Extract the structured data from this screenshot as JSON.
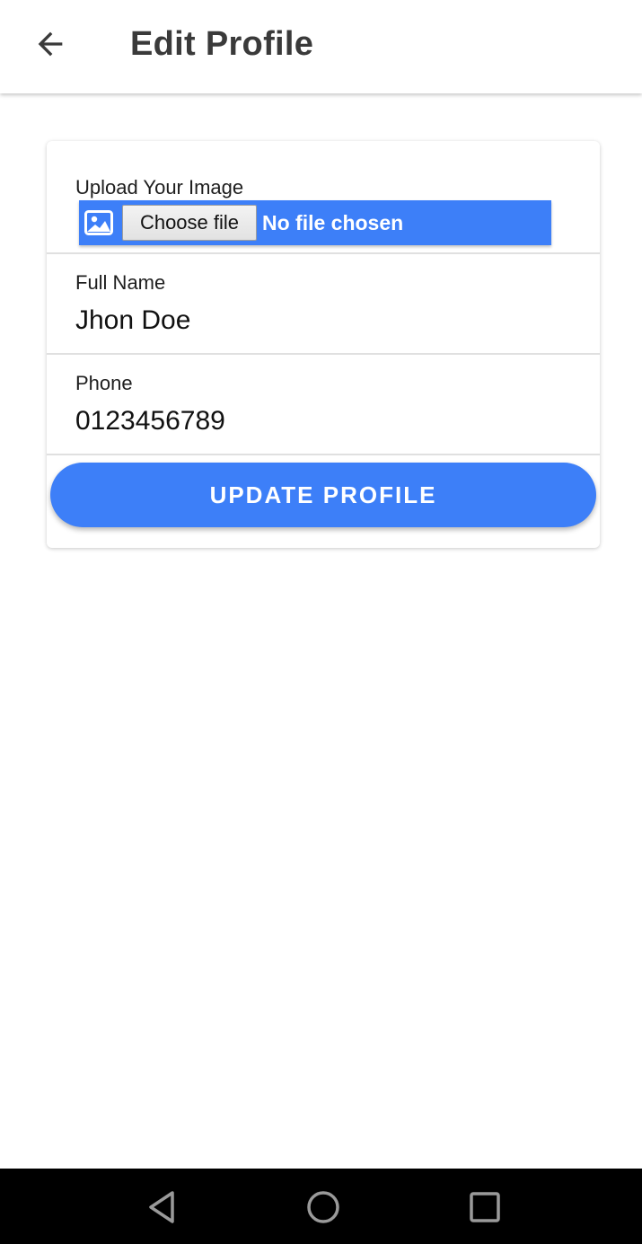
{
  "appbar": {
    "title": "Edit Profile",
    "back_icon": "arrow-left-icon"
  },
  "form": {
    "upload_label": "Upload Your Image",
    "image_icon": "image-icon",
    "choose_file_label": "Choose file",
    "file_status": "No file chosen",
    "full_name_label": "Full Name",
    "full_name_value": "Jhon Doe",
    "phone_label": "Phone",
    "phone_value": "0123456789",
    "submit_label": "UPDATE PROFILE"
  },
  "navbar": {
    "back_icon": "triangle-back-icon",
    "home_icon": "circle-home-icon",
    "recents_icon": "square-recents-icon"
  },
  "colors": {
    "accent": "#3d7ff8",
    "title_text": "#3a3a3a",
    "navbar_bg": "#000000"
  }
}
